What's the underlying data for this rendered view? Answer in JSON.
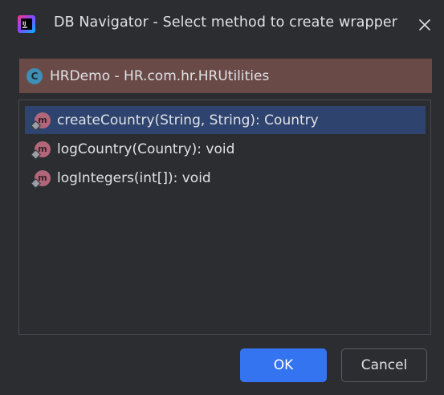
{
  "window": {
    "title": "DB Navigator - Select method to create wrapper",
    "app_icon": "jetbrains-app-icon",
    "close_icon": "close-icon"
  },
  "class_header": {
    "icon": "class-icon",
    "icon_letter": "C",
    "label": "HRDemo - HR.com.hr.HRUtilities"
  },
  "methods": [
    {
      "icon": "method-icon",
      "icon_letter": "m",
      "label": "createCountry(String, String): Country",
      "selected": true
    },
    {
      "icon": "method-icon",
      "icon_letter": "m",
      "label": "logCountry(Country): void",
      "selected": false
    },
    {
      "icon": "method-icon",
      "icon_letter": "m",
      "label": "logIntegers(int[]): void",
      "selected": false
    }
  ],
  "buttons": {
    "ok_label": "OK",
    "cancel_label": "Cancel"
  },
  "colors": {
    "background": "#2b2d30",
    "header_bg": "#6a4a47",
    "selection_bg": "#2e436e",
    "primary_button": "#3574f0"
  }
}
